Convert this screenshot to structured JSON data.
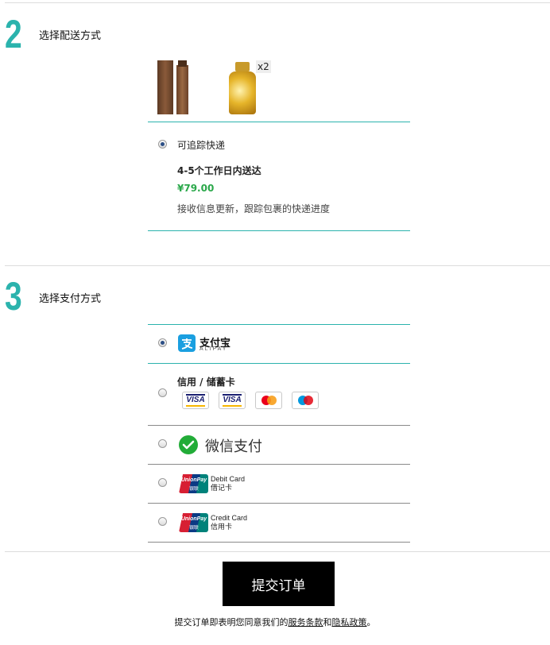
{
  "delivery": {
    "step_number": "2",
    "title": "选择配送方式",
    "product_quantity": "x2",
    "option_label": "可追踪快递",
    "eta": "4-5个工作日内送达",
    "price": "¥79.00",
    "description": "接收信息更新，跟踪包裹的快递进度",
    "selected": true
  },
  "payment": {
    "step_number": "3",
    "title": "选择支付方式",
    "alipay": {
      "cn": "支付宝",
      "en": "ALIPAY",
      "selected": true
    },
    "card": {
      "label": "信用 / 储蓄卡",
      "logos": [
        "VISA",
        "VISA",
        "mastercard",
        "maestro"
      ]
    },
    "wechat": {
      "label": "微信支付"
    },
    "unionpay_debit": {
      "en": "Debit Card",
      "cn": "借记卡",
      "logo_en": "UnionPay",
      "logo_cn": "银联"
    },
    "unionpay_credit": {
      "en": "Credit Card",
      "cn": "信用卡",
      "logo_en": "UnionPay",
      "logo_cn": "银联"
    }
  },
  "submit": {
    "button_label": "提交订单",
    "terms_prefix": "提交订单即表明您同意我们的",
    "terms_link": "服务条款",
    "terms_and": "和",
    "privacy_link": "隐私政策",
    "terms_suffix": "。"
  },
  "colors": {
    "accent": "#2bb3ad",
    "price": "#2aa84a",
    "radio_dot": "#2c4f86"
  }
}
